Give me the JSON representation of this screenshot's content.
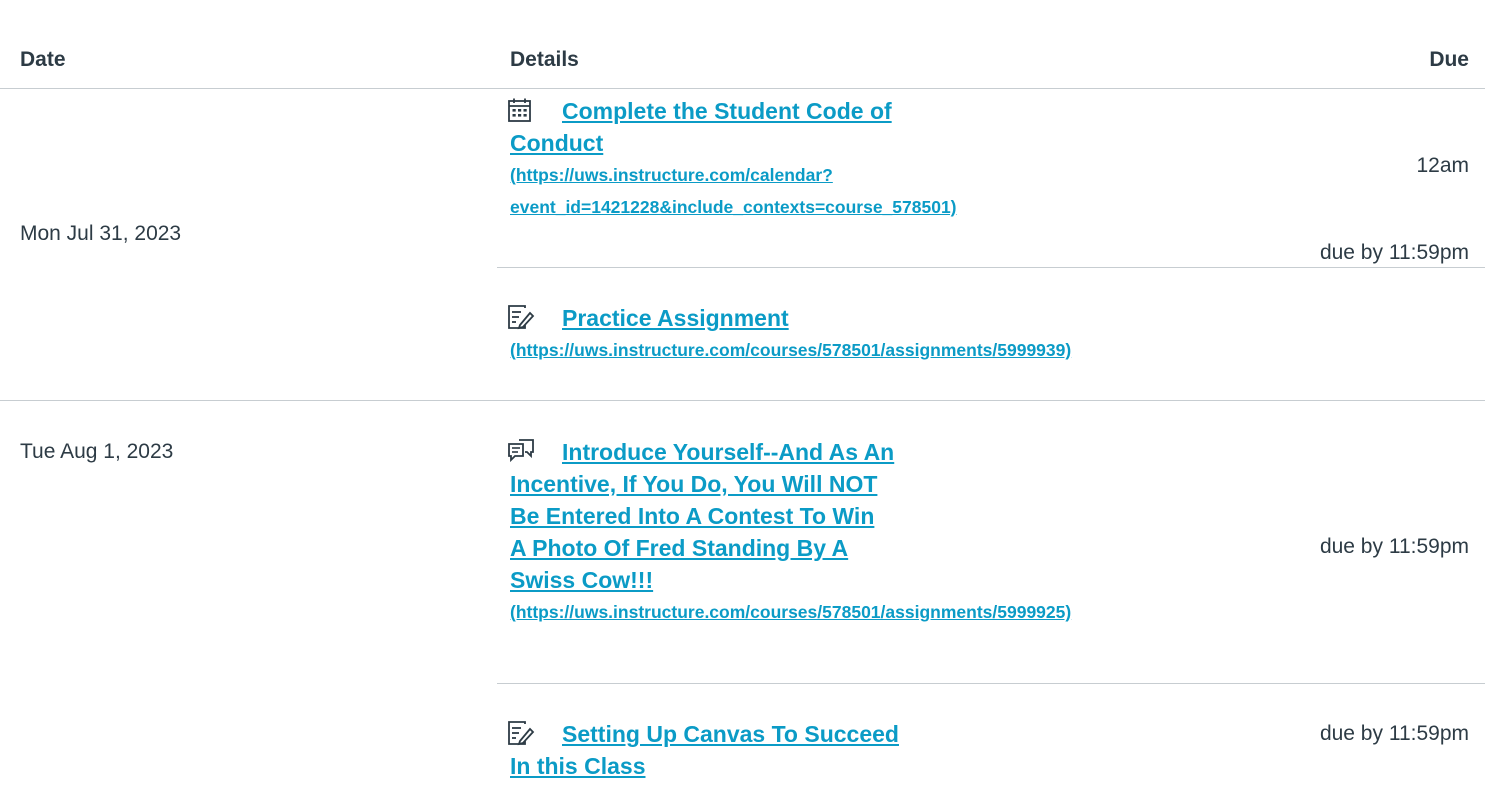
{
  "headers": {
    "date": "Date",
    "details": "Details",
    "due": "Due"
  },
  "rows": [
    {
      "date": "Mon Jul 31, 2023",
      "items": [
        {
          "icon": "calendar-icon",
          "title_lines": [
            "Complete the Student Code of",
            "Conduct"
          ],
          "url_lines": [
            "(https://uws.instructure.com/calendar?",
            "event_id=1421228&include_contexts=course_578501)"
          ],
          "due": "12am"
        },
        {
          "icon": "assignment-icon",
          "title_lines": [
            "Practice Assignment"
          ],
          "url_lines": [
            "(https://uws.instructure.com/courses/578501/assignments/5999939)"
          ],
          "due": "due by 11:59pm"
        }
      ]
    },
    {
      "date": "Tue Aug 1, 2023",
      "items": [
        {
          "icon": "discussion-icon",
          "title_lines": [
            "Introduce Yourself--And As An",
            "Incentive, If You Do, You Will NOT",
            "Be Entered Into A Contest To Win",
            "A Photo Of Fred Standing By A",
            "Swiss Cow!!!"
          ],
          "url_lines": [
            "(https://uws.instructure.com/courses/578501/assignments/5999925)"
          ],
          "due": "due by 11:59pm"
        },
        {
          "icon": "assignment-icon",
          "title_lines": [
            "Setting Up Canvas To Succeed",
            "In this Class"
          ],
          "url_lines": [],
          "due": "due by 11:59pm"
        }
      ]
    }
  ]
}
